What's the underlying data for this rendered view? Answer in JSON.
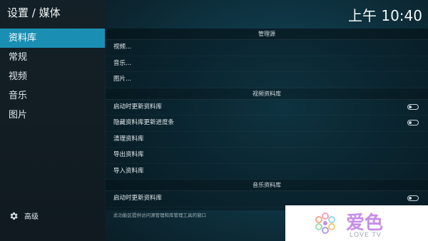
{
  "header": {
    "title": "设置 / 媒体",
    "clock": "上午 10:40"
  },
  "sidebar": {
    "items": [
      {
        "label": "资料库",
        "active": true
      },
      {
        "label": "常规"
      },
      {
        "label": "视频"
      },
      {
        "label": "音乐"
      },
      {
        "label": "图片"
      }
    ],
    "bottom_label": "高级",
    "bottom_icon": "gear-icon"
  },
  "sections": {
    "sources": {
      "title": "管理源",
      "items": [
        "视频...",
        "音乐...",
        "图片..."
      ]
    },
    "video_library": {
      "title": "视频资料库",
      "update_on_start": "启动时更新资料库",
      "hide_progress": "隐藏资料库更新进度条",
      "clean": "清理资料库",
      "export": "导出资料库",
      "import": "导入资料库"
    },
    "music_library": {
      "title": "音乐资料库",
      "update_on_start": "启动时更新资料库"
    }
  },
  "description": "此功能区提供访问源管理和库管理工具的窗口",
  "watermark": {
    "text": "爱色",
    "subtext": "LOVE TV"
  },
  "colors": {
    "accent": "#1b8fb3",
    "logo": "#c68ee8"
  }
}
